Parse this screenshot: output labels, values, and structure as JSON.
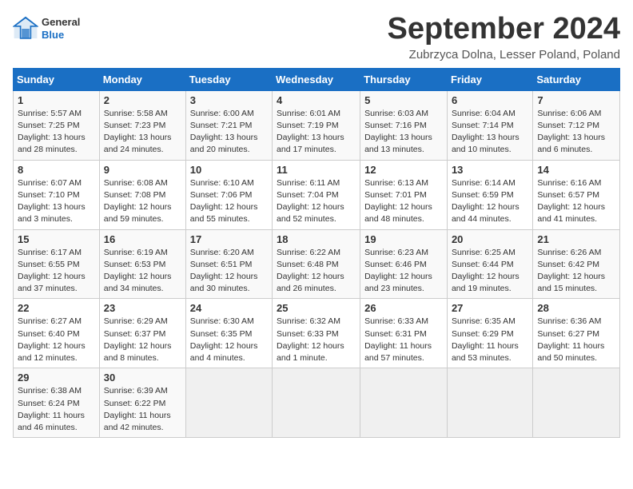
{
  "header": {
    "logo_general": "General",
    "logo_blue": "Blue",
    "month_title": "September 2024",
    "location": "Zubrzyca Dolna, Lesser Poland, Poland"
  },
  "weekdays": [
    "Sunday",
    "Monday",
    "Tuesday",
    "Wednesday",
    "Thursday",
    "Friday",
    "Saturday"
  ],
  "weeks": [
    [
      {
        "day": "1",
        "sunrise": "5:57 AM",
        "sunset": "7:25 PM",
        "daylight": "13 hours and 28 minutes."
      },
      {
        "day": "2",
        "sunrise": "5:58 AM",
        "sunset": "7:23 PM",
        "daylight": "13 hours and 24 minutes."
      },
      {
        "day": "3",
        "sunrise": "6:00 AM",
        "sunset": "7:21 PM",
        "daylight": "13 hours and 20 minutes."
      },
      {
        "day": "4",
        "sunrise": "6:01 AM",
        "sunset": "7:19 PM",
        "daylight": "13 hours and 17 minutes."
      },
      {
        "day": "5",
        "sunrise": "6:03 AM",
        "sunset": "7:16 PM",
        "daylight": "13 hours and 13 minutes."
      },
      {
        "day": "6",
        "sunrise": "6:04 AM",
        "sunset": "7:14 PM",
        "daylight": "13 hours and 10 minutes."
      },
      {
        "day": "7",
        "sunrise": "6:06 AM",
        "sunset": "7:12 PM",
        "daylight": "13 hours and 6 minutes."
      }
    ],
    [
      {
        "day": "8",
        "sunrise": "6:07 AM",
        "sunset": "7:10 PM",
        "daylight": "13 hours and 3 minutes."
      },
      {
        "day": "9",
        "sunrise": "6:08 AM",
        "sunset": "7:08 PM",
        "daylight": "12 hours and 59 minutes."
      },
      {
        "day": "10",
        "sunrise": "6:10 AM",
        "sunset": "7:06 PM",
        "daylight": "12 hours and 55 minutes."
      },
      {
        "day": "11",
        "sunrise": "6:11 AM",
        "sunset": "7:04 PM",
        "daylight": "12 hours and 52 minutes."
      },
      {
        "day": "12",
        "sunrise": "6:13 AM",
        "sunset": "7:01 PM",
        "daylight": "12 hours and 48 minutes."
      },
      {
        "day": "13",
        "sunrise": "6:14 AM",
        "sunset": "6:59 PM",
        "daylight": "12 hours and 44 minutes."
      },
      {
        "day": "14",
        "sunrise": "6:16 AM",
        "sunset": "6:57 PM",
        "daylight": "12 hours and 41 minutes."
      }
    ],
    [
      {
        "day": "15",
        "sunrise": "6:17 AM",
        "sunset": "6:55 PM",
        "daylight": "12 hours and 37 minutes."
      },
      {
        "day": "16",
        "sunrise": "6:19 AM",
        "sunset": "6:53 PM",
        "daylight": "12 hours and 34 minutes."
      },
      {
        "day": "17",
        "sunrise": "6:20 AM",
        "sunset": "6:51 PM",
        "daylight": "12 hours and 30 minutes."
      },
      {
        "day": "18",
        "sunrise": "6:22 AM",
        "sunset": "6:48 PM",
        "daylight": "12 hours and 26 minutes."
      },
      {
        "day": "19",
        "sunrise": "6:23 AM",
        "sunset": "6:46 PM",
        "daylight": "12 hours and 23 minutes."
      },
      {
        "day": "20",
        "sunrise": "6:25 AM",
        "sunset": "6:44 PM",
        "daylight": "12 hours and 19 minutes."
      },
      {
        "day": "21",
        "sunrise": "6:26 AM",
        "sunset": "6:42 PM",
        "daylight": "12 hours and 15 minutes."
      }
    ],
    [
      {
        "day": "22",
        "sunrise": "6:27 AM",
        "sunset": "6:40 PM",
        "daylight": "12 hours and 12 minutes."
      },
      {
        "day": "23",
        "sunrise": "6:29 AM",
        "sunset": "6:37 PM",
        "daylight": "12 hours and 8 minutes."
      },
      {
        "day": "24",
        "sunrise": "6:30 AM",
        "sunset": "6:35 PM",
        "daylight": "12 hours and 4 minutes."
      },
      {
        "day": "25",
        "sunrise": "6:32 AM",
        "sunset": "6:33 PM",
        "daylight": "12 hours and 1 minute."
      },
      {
        "day": "26",
        "sunrise": "6:33 AM",
        "sunset": "6:31 PM",
        "daylight": "11 hours and 57 minutes."
      },
      {
        "day": "27",
        "sunrise": "6:35 AM",
        "sunset": "6:29 PM",
        "daylight": "11 hours and 53 minutes."
      },
      {
        "day": "28",
        "sunrise": "6:36 AM",
        "sunset": "6:27 PM",
        "daylight": "11 hours and 50 minutes."
      }
    ],
    [
      {
        "day": "29",
        "sunrise": "6:38 AM",
        "sunset": "6:24 PM",
        "daylight": "11 hours and 46 minutes."
      },
      {
        "day": "30",
        "sunrise": "6:39 AM",
        "sunset": "6:22 PM",
        "daylight": "11 hours and 42 minutes."
      },
      null,
      null,
      null,
      null,
      null
    ]
  ]
}
